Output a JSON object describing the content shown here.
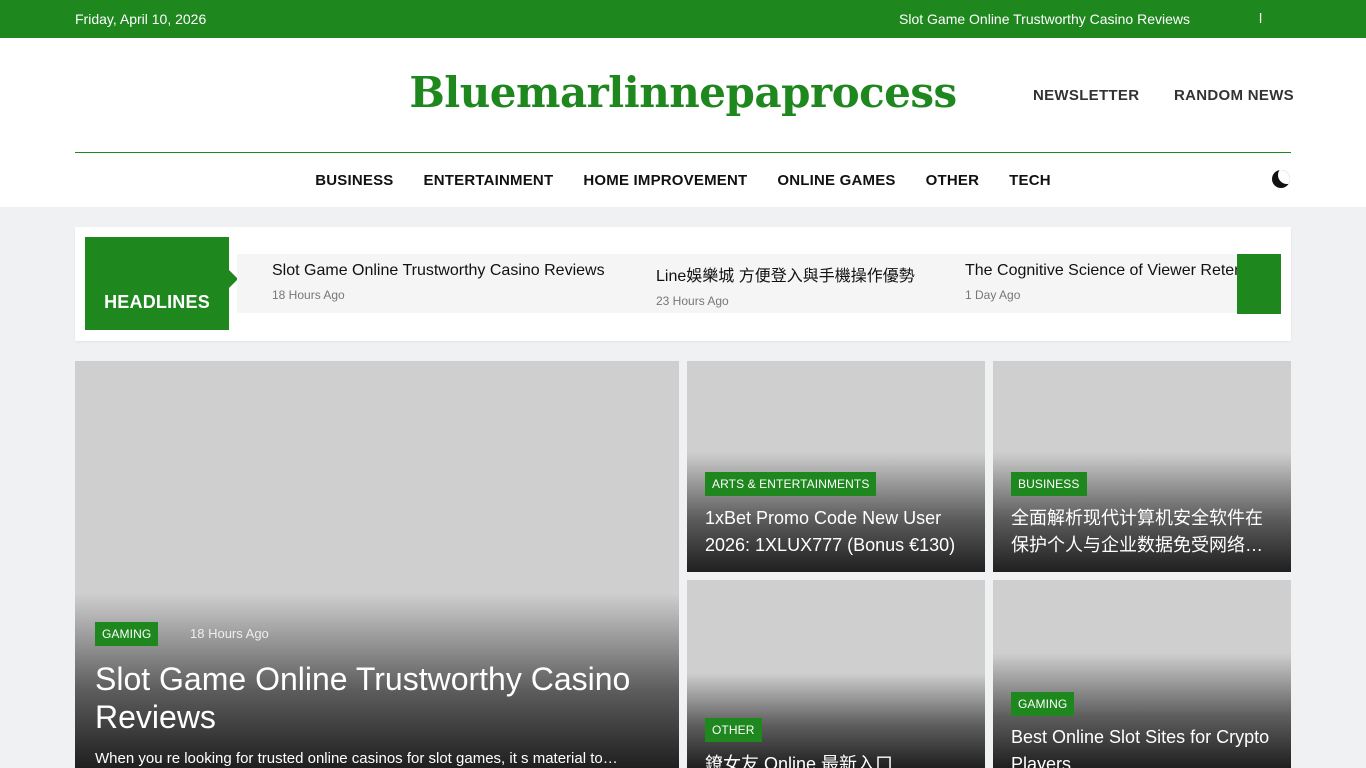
{
  "topbar": {
    "date": "Friday, April 10, 2026",
    "ticker": "Slot Game Online Trustworthy Casino Reviews",
    "separator": "l"
  },
  "header": {
    "site_title": "Bluemarlinnepaprocess",
    "links": {
      "newsletter": "NEWSLETTER",
      "random_news": "RANDOM NEWS"
    },
    "dark_mode_icon": "moon-icon"
  },
  "nav": {
    "items": [
      "BUSINESS",
      "ENTERTAINMENT",
      "HOME IMPROVEMENT",
      "ONLINE GAMES",
      "OTHER",
      "TECH"
    ]
  },
  "headlines": {
    "label": "HEADLINES",
    "items": [
      {
        "title": "Slot Game Online Trustworthy Casino Reviews",
        "time": "18 Hours Ago"
      },
      {
        "title": "Line娛樂城 方便登入與手機操作優勢",
        "time": "23 Hours Ago"
      },
      {
        "title": "The Cognitive Science of Viewer Reten",
        "time": "1 Day Ago"
      }
    ]
  },
  "featured": {
    "category": "GAMING",
    "time": "18 Hours Ago",
    "title": "Slot Game Online Trustworthy Casino Reviews",
    "excerpt": "When you re looking for trusted online casinos for slot games, it s material to…"
  },
  "cards": [
    {
      "category": "ARTS & ENTERTAINMENTS",
      "title": "1xBet Promo Code New User 2026: 1XLUX777 (Bonus €130)"
    },
    {
      "category": "BUSINESS",
      "title": "全面解析现代计算机安全软件在保护个人与企业数据免受网络威胁中的重要作用"
    },
    {
      "category": "OTHER",
      "title": "鐐女友 Online 最新入口"
    },
    {
      "category": "GAMING",
      "title": "Best Online Slot Sites for Crypto Players"
    }
  ],
  "colors": {
    "brand": "#1e871e",
    "card_placeholder": "#cfcfcf"
  }
}
